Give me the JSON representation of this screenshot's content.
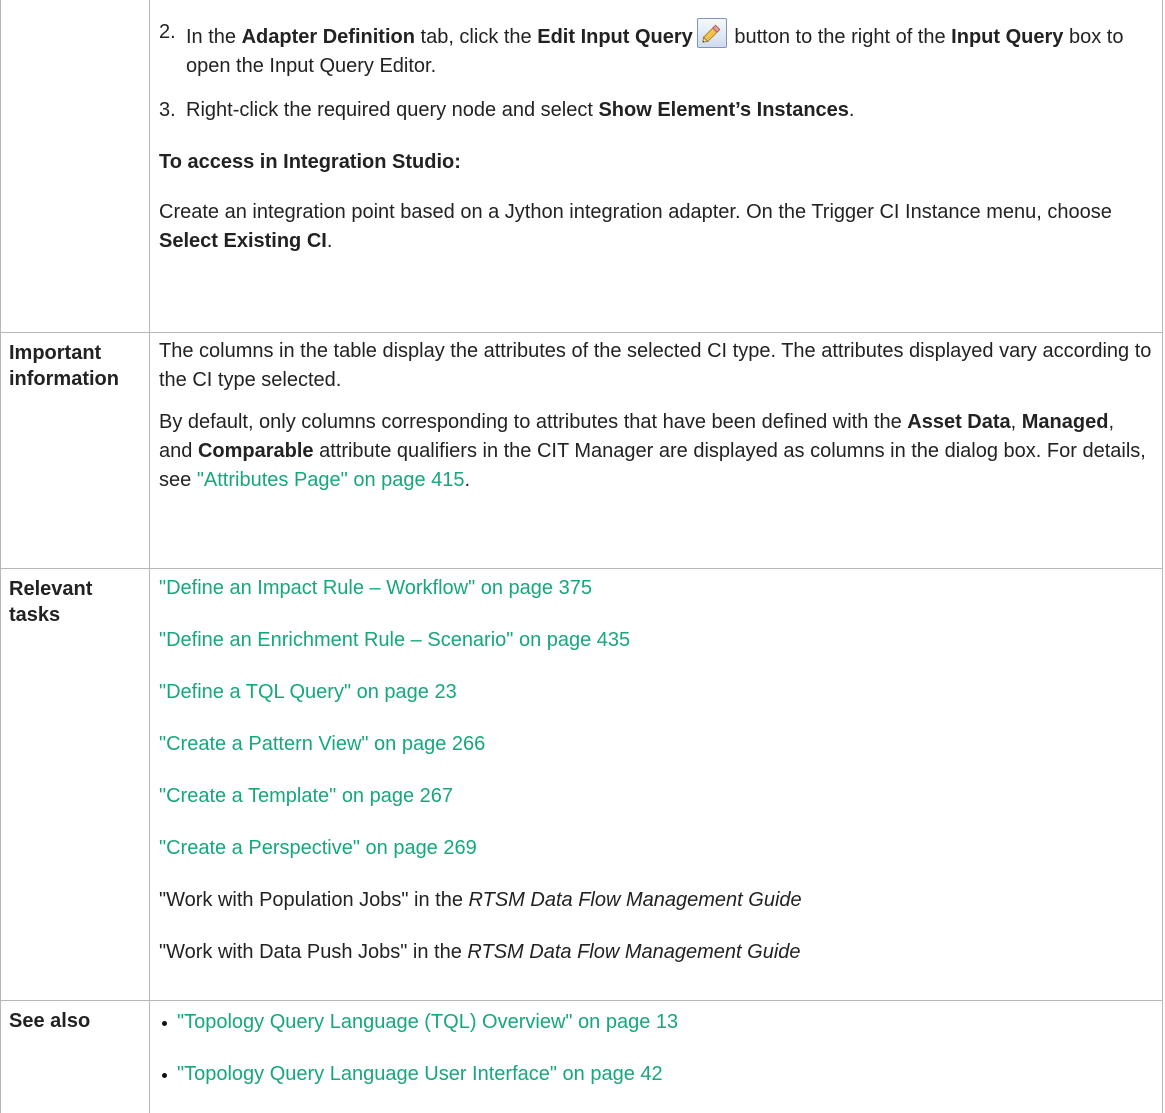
{
  "steps": [
    {
      "number": "2.",
      "p1": "In the ",
      "b1": "Adapter Definition",
      "p2": " tab, click the ",
      "b2": "Edit Input Query",
      "icon": "edit-pencil-icon",
      "p3": " button to the right of the ",
      "b3": "Input Query",
      "p4": " box to open the Input Query Editor."
    },
    {
      "number": "3.",
      "p1": "Right-click the required query node and select ",
      "b1": "Show Element’s Instances",
      "p2": "."
    }
  ],
  "integration": {
    "heading": "To access in Integration Studio:",
    "p1": "Create an integration point based on a Jython integration adapter. On the Trigger CI Instance menu, choose ",
    "b1": "Select Existing CI",
    "p2": "."
  },
  "important": {
    "label": "Important information",
    "para1": "The columns in the table display the attributes of the selected CI type. The attributes displayed vary according to the CI type selected.",
    "para2": {
      "p1": "By default, only columns corresponding to attributes that have been defined with the ",
      "b1": "Asset Data",
      "p2": ", ",
      "b2": "Managed",
      "p3": ", and ",
      "b3": "Comparable",
      "p4": " attribute qualifiers in the CIT Manager are displayed as columns in the dialog box. For details, see ",
      "link": "\"Attributes Page\" on page 415",
      "p5": "."
    }
  },
  "relevant": {
    "label": "Relevant tasks",
    "links": [
      "\"Define an Impact Rule – Workflow\" on page 375",
      "\"Define an Enrichment Rule – Scenario\" on page 435",
      "\"Define a TQL Query\" on page 23",
      "\"Create a Pattern View\" on page 266",
      "\"Create a Template\" on page 267",
      "\"Create a Perspective\" on page 269"
    ],
    "extra": [
      {
        "p1": "\"Work with Population Jobs\" in the ",
        "i1": "RTSM Data Flow Management Guide"
      },
      {
        "p1": "\"Work with Data Push Jobs\" in the ",
        "i1": "RTSM Data Flow Management Guide"
      }
    ]
  },
  "see_also": {
    "label": "See also",
    "links": [
      "\"Topology Query Language (TQL) Overview\" on page 13",
      "\"Topology Query Language User Interface\" on page 42"
    ]
  },
  "colors": {
    "link": "#16a77c",
    "border": "#b7b7b7",
    "text": "#222222"
  }
}
